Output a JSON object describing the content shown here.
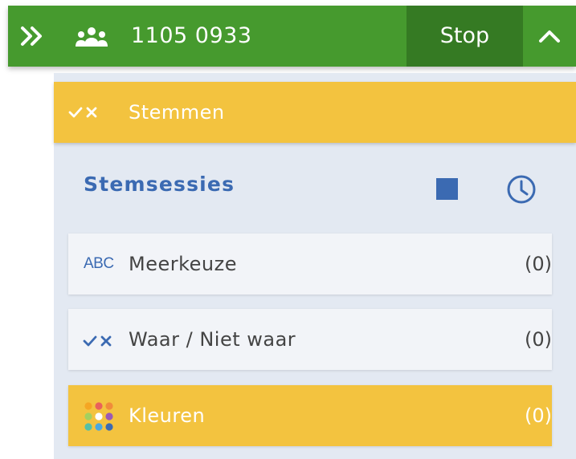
{
  "topbar": {
    "session_code": "1105 0933",
    "stop_label": "Stop",
    "icons": {
      "expand": "double-chevron-right-icon",
      "participants": "users-icon",
      "collapse": "chevron-up-icon"
    }
  },
  "section": {
    "title": "Stemmen",
    "icon": "check-cross-icon"
  },
  "sessions": {
    "title": "Stemsessies",
    "icons": {
      "stop": "stop-square-icon",
      "history": "clock-icon"
    }
  },
  "items": [
    {
      "label": "Meerkeuze",
      "count": "(0)",
      "icon": "abc-icon",
      "icon_text": "ABC",
      "active": false
    },
    {
      "label": "Waar / Niet waar",
      "count": "(0)",
      "icon": "check-cross-icon",
      "active": false
    },
    {
      "label": "Kleuren",
      "count": "(0)",
      "icon": "color-dots-icon",
      "active": true
    }
  ],
  "colors": {
    "topbar_green": "#469a2e",
    "stop_green": "#357a23",
    "accent_yellow": "#f3c33f",
    "accent_blue": "#3b6ab2",
    "panel_bg": "#e3e9f2",
    "item_bg": "#f2f4f8",
    "palette": [
      "#f5a623",
      "#e9615b",
      "#f08c3a",
      "#a4d05f",
      "#ffffff",
      "#9b59b6",
      "#56c0a7",
      "#4aa8e0",
      "#3b6ab2"
    ]
  }
}
